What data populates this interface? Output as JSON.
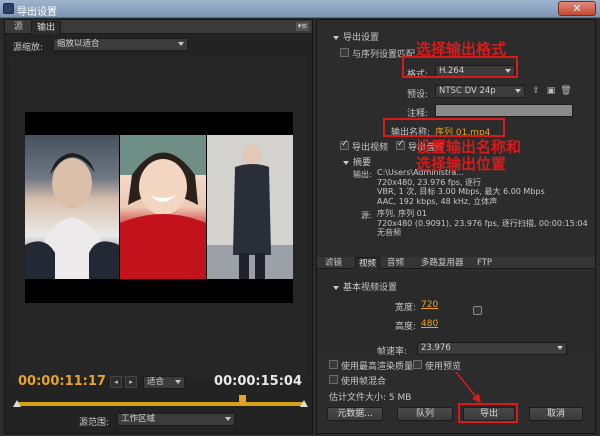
{
  "window": {
    "title": "导出设置",
    "close_label": "✕"
  },
  "left_panel": {
    "tabs": [
      "源",
      "输出"
    ],
    "source_scaling_label": "源缩放:",
    "source_scaling_value": "缩放以适合",
    "timecode_start": "00:00:11:17",
    "timecode_end": "00:00:15:04",
    "fit_value": "适合",
    "source_range_label": "源范围:",
    "source_range_value": "工作区域"
  },
  "export_settings": {
    "header": "导出设置",
    "match_sequence_label": "与序列设置匹配",
    "format_label": "格式:",
    "format_value": "H.264",
    "preset_label": "预设:",
    "preset_value": "NTSC DV 24p",
    "comments_label": "注释:",
    "output_name_label": "输出名称:",
    "output_name_value": "序列 01.mp4",
    "export_video_label": "导出视频",
    "export_audio_label": "导出音频"
  },
  "summary": {
    "header": "摘要",
    "output_label": "输出:",
    "output_lines": [
      "C:\\Users\\Administra...",
      "720x480, 23.976 fps, 逐行",
      "VBR, 1 次, 目标 3.00 Mbps, 最大 6.00 Mbps",
      "AAC, 192 kbps, 48 kHz, 立体声"
    ],
    "source_label": "源:",
    "source_lines": [
      "序列, 序列 01",
      "720x480 (0.9091), 23.976 fps, 逐行扫描, 00:00:15:04",
      "无音频"
    ]
  },
  "lower_tabs": [
    "滤镜",
    "视频",
    "音频",
    "多路复用器",
    "FTP"
  ],
  "basic_video": {
    "header": "基本视频设置",
    "width_label": "宽度:",
    "width_value": "720",
    "height_label": "高度:",
    "height_value": "480",
    "frame_rate_label": "帧速率:",
    "frame_rate_value": "23.976"
  },
  "options": {
    "max_render_quality": "使用最高渲染质量",
    "use_previews": "使用预览",
    "use_frame_blending": "使用帧混合",
    "estimated_file_size": "估计文件大小: 5 MB"
  },
  "buttons": {
    "metadata": "元数据...",
    "queue": "队列",
    "export": "导出",
    "cancel": "取消"
  },
  "annotations": {
    "select_format": "选择输出格式",
    "set_name_line1": "设置输出名称和",
    "set_name_line2": "选择输出位置"
  },
  "colors": {
    "accent": "#e8a328",
    "annotation_red": "#d51b1b"
  }
}
